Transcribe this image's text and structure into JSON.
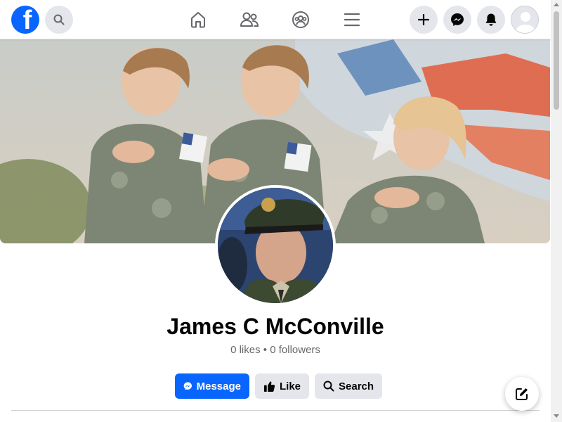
{
  "nav": {
    "logo_letter": "f",
    "icons": [
      "search-icon",
      "home-icon",
      "friends-icon",
      "groups-icon",
      "menu-icon",
      "plus-icon",
      "messenger-icon",
      "bell-icon",
      "avatar-icon"
    ]
  },
  "profile": {
    "name": "James C McConville",
    "likes": "0 likes",
    "separator": "•",
    "followers": "0 followers"
  },
  "actions": {
    "message_label": "Message",
    "like_label": "Like",
    "search_label": "Search"
  },
  "colors": {
    "brand": "#0866ff",
    "secondary_button": "#e4e6eb",
    "text_primary": "#050505",
    "text_secondary": "#65676b"
  }
}
